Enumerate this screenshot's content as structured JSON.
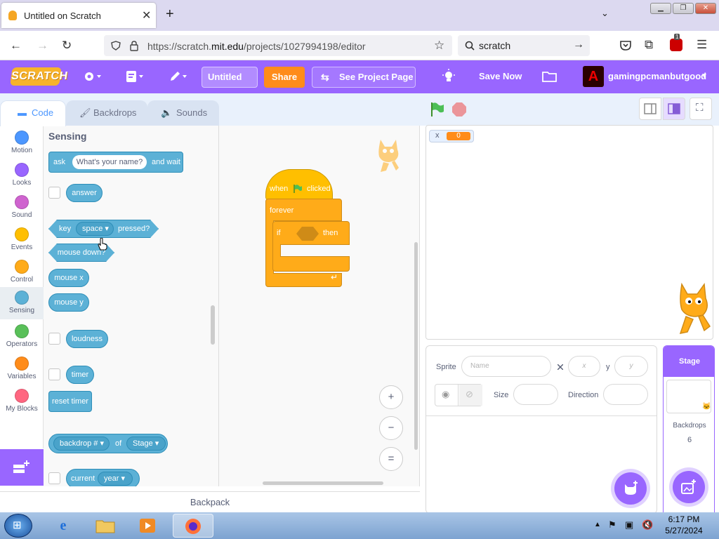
{
  "browser": {
    "tab_title": "Untitled on Scratch",
    "new_tab": "+",
    "close_tab": "✕",
    "tab_list": "⌄",
    "url_prefix": "https://scratch.",
    "url_domain": "mit.edu",
    "url_path": "/projects/1027994198/editor",
    "search_text": "scratch",
    "ext_badge": "1"
  },
  "menubar": {
    "logo": "SCRATCH",
    "project_title": "Untitled",
    "share": "Share",
    "see_project": "See Project Page",
    "save_now": "Save Now",
    "username": "gamingpcmanbutgood",
    "avatar_letter": "A"
  },
  "tabs": {
    "code": "Code",
    "backdrops": "Backdrops",
    "sounds": "Sounds"
  },
  "categories": [
    {
      "label": "Motion",
      "color": "#4c97ff"
    },
    {
      "label": "Looks",
      "color": "#9966ff"
    },
    {
      "label": "Sound",
      "color": "#cf63cf"
    },
    {
      "label": "Events",
      "color": "#ffbf00"
    },
    {
      "label": "Control",
      "color": "#ffab19"
    },
    {
      "label": "Sensing",
      "color": "#5cb1d6"
    },
    {
      "label": "Operators",
      "color": "#59c059"
    },
    {
      "label": "Variables",
      "color": "#ff8c1a"
    },
    {
      "label": "My Blocks",
      "color": "#ff6680"
    }
  ],
  "palette": {
    "heading": "Sensing",
    "ask": "ask",
    "ask_default": "What's your name?",
    "and_wait": "and wait",
    "answer": "answer",
    "key": "key",
    "key_option": "space",
    "pressed": "pressed?",
    "mouse_down": "mouse down?",
    "mouse_x": "mouse x",
    "mouse_y": "mouse y",
    "loudness": "loudness",
    "timer": "timer",
    "reset_timer": "reset timer",
    "backdrop_num": "backdrop #",
    "of": "of",
    "stage_option": "Stage",
    "current": "current",
    "year_option": "year"
  },
  "script": {
    "when": "when",
    "clicked": "clicked",
    "forever": "forever",
    "if": "if",
    "then": "then"
  },
  "zoom": {
    "in": "+",
    "out": "−",
    "reset": "="
  },
  "stage": {
    "var_label": "x",
    "var_value": "0"
  },
  "sprite_info": {
    "sprite": "Sprite",
    "name_placeholder": "Name",
    "x_label": "x",
    "x_placeholder": "x",
    "y_label": "y",
    "y_placeholder": "y",
    "size": "Size",
    "direction": "Direction"
  },
  "stage_pane": {
    "title": "Stage",
    "backdrops": "Backdrops",
    "count": "6"
  },
  "backpack": "Backpack",
  "taskbar": {
    "time": "6:17 PM",
    "date": "5/27/2024"
  },
  "colors": {
    "accent": "#9966ff",
    "sensing": "#5cb1d6",
    "events": "#ffbf00",
    "control": "#ffab19",
    "share": "#ff8c1a"
  }
}
